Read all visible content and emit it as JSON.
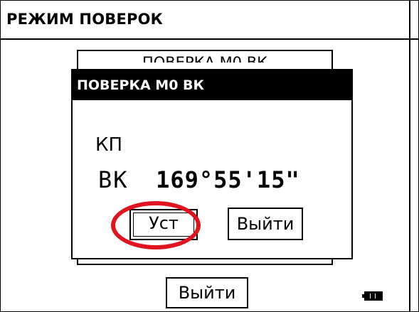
{
  "header": {
    "title": "РЕЖИМ ПОВЕРОК"
  },
  "background_panel": {
    "title": "ПОВЕРКА М0 ВК"
  },
  "dialog": {
    "title": "ПОВЕРКА М0 ВК",
    "face": "КП",
    "reading_label": "ВК",
    "reading_value": "169°55'15\"",
    "set_button": "Уст",
    "exit_button": "Выйти"
  },
  "footer": {
    "exit_button": "Выйти"
  },
  "icons": {
    "battery": "battery-full-icon"
  },
  "colors": {
    "highlight": "#e0141f"
  }
}
